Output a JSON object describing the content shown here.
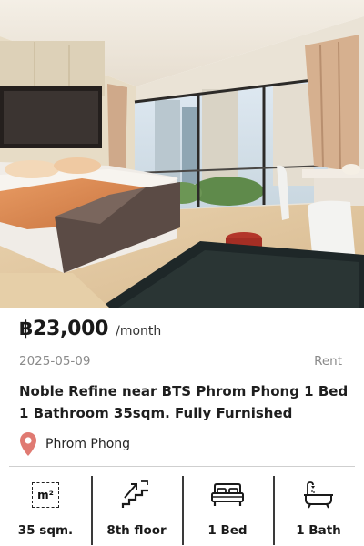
{
  "listing": {
    "price": "฿23,000",
    "period": "/month",
    "date": "2025-05-09",
    "type": "Rent",
    "title": "Noble Refine near BTS Phrom Phong 1 Bed 1 Bathroom 35sqm. Fully Furnished",
    "location": "Phrom Phong"
  },
  "features": [
    {
      "icon": "area-icon",
      "label": "35 sqm.",
      "icon_text": "m²"
    },
    {
      "icon": "stairs-icon",
      "label": "8th floor"
    },
    {
      "icon": "bed-icon",
      "label": "1 Bed"
    },
    {
      "icon": "bathtub-icon",
      "label": "1 Bath"
    }
  ],
  "colors": {
    "pin": "#e07a72",
    "divider": "#cfcfcf"
  }
}
